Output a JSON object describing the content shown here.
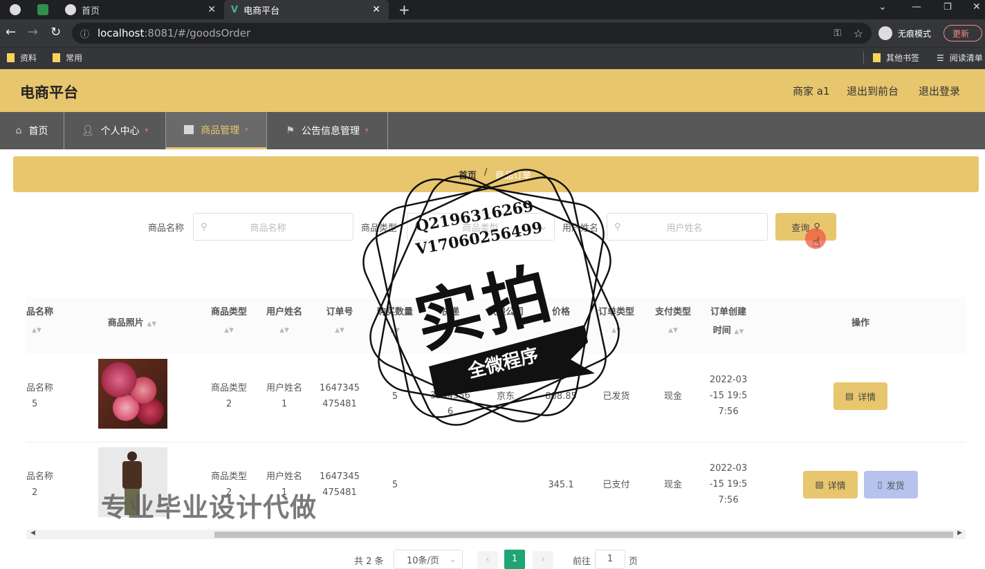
{
  "browser": {
    "tabs": [
      {
        "label": "首页"
      },
      {
        "label": "电商平台"
      }
    ],
    "url_host": "localhost",
    "url_rest": ":8081/#/goodsOrder",
    "incognito_label": "无痕模式",
    "update_label": "更新",
    "bookmarks": [
      "资料",
      "常用"
    ],
    "bookmarks_right": [
      "其他书签",
      "阅读清单"
    ]
  },
  "header": {
    "title": "电商平台",
    "user": "商家 a1",
    "to_front": "退出到前台",
    "logout": "退出登录"
  },
  "nav": {
    "items": [
      {
        "label": "首页"
      },
      {
        "label": "个人中心"
      },
      {
        "label": "商品管理"
      },
      {
        "label": "公告信息管理"
      }
    ]
  },
  "breadcrumb": {
    "home": "首页",
    "sep": "/",
    "current": "商品订单"
  },
  "search": {
    "name_label": "商品名称",
    "name_placeholder": "商品名称",
    "type_label": "商品类型",
    "type_placeholder": "商品类型",
    "user_label": "用户姓名",
    "user_placeholder": "用户姓名",
    "query_button": "查询"
  },
  "table": {
    "headers": {
      "name": "品名称",
      "photo": "商品照片",
      "type": "商品类型",
      "user": "用户姓名",
      "order_no": "订单号",
      "qty": "购买数量",
      "express_no": "快递",
      "express_co": "快递公司",
      "price": "价格",
      "status": "订单类型",
      "pay": "支付类型",
      "created_1": "订单创建",
      "created_2": "时间",
      "ops": "操作"
    },
    "rows": [
      {
        "name_1": "品名称",
        "name_2": "5",
        "type_1": "商品类型",
        "type_2": "2",
        "user_1": "用户姓名",
        "user_2": "1",
        "order_1": "1647345",
        "order_2": "475481",
        "qty": "5",
        "express_1": "0 1",
        "express_2": "3344556",
        "express_3": "6",
        "express_co": "京东",
        "price": "808.85",
        "status": "已发货",
        "pay": "现金",
        "time_1": "2022-03",
        "time_2": "-15 19:5",
        "time_3": "7:56",
        "detail": "详情"
      },
      {
        "name_1": "品名称",
        "name_2": "2",
        "type_1": "商品类型",
        "type_2": "2",
        "user_1": "用户姓名",
        "user_2": "1",
        "order_1": "1647345",
        "order_2": "475481",
        "qty": "5",
        "price": "345.1",
        "status": "已支付",
        "pay": "现金",
        "time_1": "2022-03",
        "time_2": "-15 19:5",
        "time_3": "7:56",
        "detail": "详情",
        "ship": "发货"
      }
    ]
  },
  "pagination": {
    "total": "共 2 条",
    "page_size": "10条/页",
    "current": "1",
    "goto": "前往",
    "goto_value": "1",
    "page_unit": "页"
  },
  "watermark": {
    "line1": "Q2196316269",
    "line2": "V17060256499",
    "big": "实拍",
    "ribbon": "全微程序",
    "bottom": "专业毕业设计代做"
  },
  "colors": {
    "accent": "#e8c66e",
    "nav": "#585858",
    "active_page": "#1ea573",
    "ship_button": "#b6c3ec"
  }
}
